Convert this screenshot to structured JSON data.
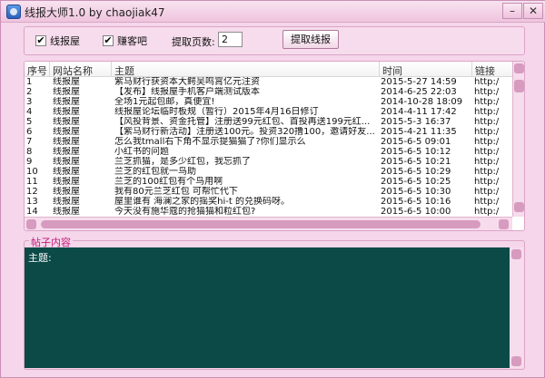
{
  "window": {
    "title": "线报大师1.0 by chaojiak47",
    "min_glyph": "–",
    "close_glyph": "✕"
  },
  "toolbar": {
    "site1": {
      "label": "线报屋",
      "checked": true,
      "mark": "✔"
    },
    "site2": {
      "label": "赚客吧",
      "checked": true,
      "mark": "✔"
    },
    "pages_label": "提取页数:",
    "pages_value": "2",
    "fetch_label": "提取线报"
  },
  "table": {
    "columns": [
      "序号",
      "网站名称",
      "主题",
      "时间",
      "链接"
    ],
    "rows": [
      [
        "1",
        "线报屋",
        "紫马财行获资本大鳄吴鸣霄亿元注资",
        "2015-5-27 14:59",
        "http:/"
      ],
      [
        "2",
        "线报屋",
        "【发布】线报屋手机客户端测试版本",
        "2014-6-25 22:03",
        "http:/"
      ],
      [
        "3",
        "线报屋",
        "全场1元起包邮，真便宜!",
        "2014-10-28 18:09",
        "http:/"
      ],
      [
        "4",
        "线报屋",
        "线报屋论坛临时板规（暂行）2015年4月16日修订",
        "2014-4-11 17:42",
        "http:/"
      ],
      [
        "5",
        "线报屋",
        "【风投背景、资金托管】注册送99元红包、首投再送199元红...",
        "2015-5-3 16:37",
        "http:/"
      ],
      [
        "6",
        "线报屋",
        "【紫马财行新活动】注册送100元。投资320撸100，邀请好友...",
        "2015-4-21 11:35",
        "http:/"
      ],
      [
        "7",
        "线报屋",
        "怎么我tmall右下角不显示提猫猫了?你们显示么",
        "2015-6-5 09:01",
        "http:/"
      ],
      [
        "8",
        "线报屋",
        "小红书的问题",
        "2015-6-5 10:12",
        "http:/"
      ],
      [
        "9",
        "线报屋",
        "兰芝抓猫，是多少红包，我忘抓了",
        "2015-6-5 10:21",
        "http:/"
      ],
      [
        "10",
        "线报屋",
        "兰芝的红包就一鸟助",
        "2015-6-5 10:29",
        "http:/"
      ],
      [
        "11",
        "线报屋",
        "兰芝的100红包有个鸟用啊",
        "2015-6-5 10:25",
        "http:/"
      ],
      [
        "12",
        "线报屋",
        "我有80元兰芝红包 可帮忙代下",
        "2015-6-5 10:30",
        "http:/"
      ],
      [
        "13",
        "线报屋",
        "屋里谁有 海澜之家的摇奖hi-t 的兑换码呀。",
        "2015-6-5 10:16",
        "http:/"
      ],
      [
        "14",
        "线报屋",
        "今天没有施华蔻的抢猫猫和粒红包?",
        "2015-6-5 10:00",
        "http:/"
      ]
    ]
  },
  "content": {
    "title": "帖子内容",
    "body": "主题:"
  }
}
